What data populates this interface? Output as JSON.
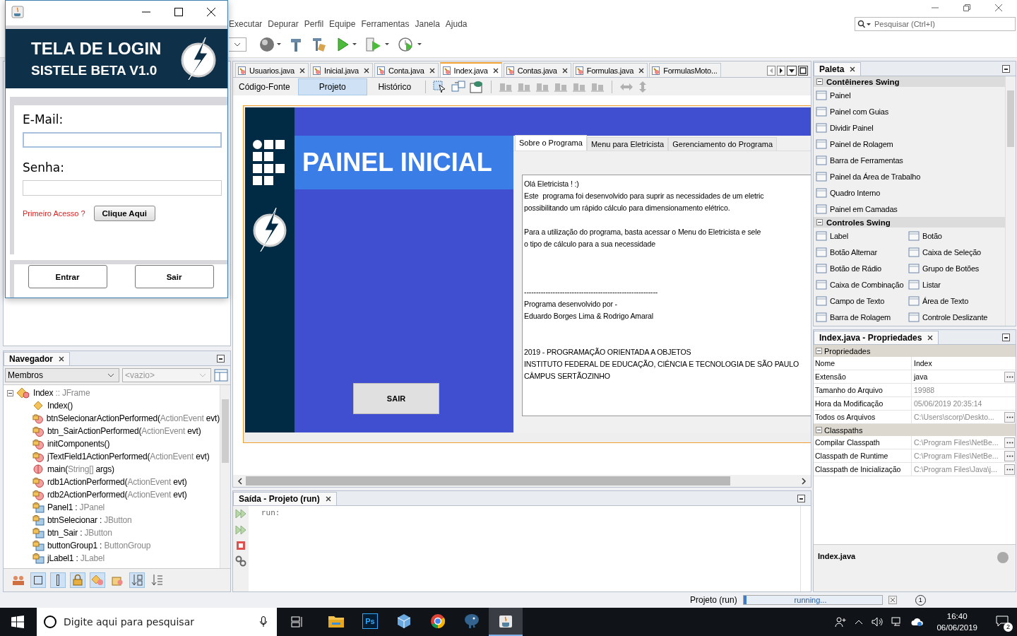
{
  "login_window": {
    "header_title": "TELA DE LOGIN",
    "header_subtitle": "SISTELE BETA V1.0",
    "fields": [
      {
        "label": "E-Mail:",
        "focused": true
      },
      {
        "label": "Senha:",
        "focused": false
      }
    ],
    "first_access_label": "Primeiro Acesso ?",
    "first_access_button": "Clique Aqui",
    "buttons": [
      "Entrar",
      "Sair"
    ]
  },
  "menu": [
    "Executar",
    "Depurar",
    "Perfil",
    "Equipe",
    "Ferramentas",
    "Janela",
    "Ajuda"
  ],
  "search": {
    "placeholder": "Pesquisar (Ctrl+I)"
  },
  "editor_tabs": [
    {
      "label": "Usuarios.java",
      "selected": false
    },
    {
      "label": "Inicial.java",
      "selected": false
    },
    {
      "label": "Conta.java",
      "selected": false
    },
    {
      "label": "Index.java",
      "selected": true
    },
    {
      "label": "Contas.java",
      "selected": false
    },
    {
      "label": "Formulas.java",
      "selected": false
    },
    {
      "label": "FormulasMoto...",
      "selected": false
    }
  ],
  "view_tabs": [
    {
      "label": "Código-Fonte",
      "selected": false
    },
    {
      "label": "Projeto",
      "selected": true
    },
    {
      "label": "Histórico",
      "selected": false
    }
  ],
  "form_preview": {
    "title": "PAINEL INICIAL",
    "exit_button": "SAIR",
    "tabs": [
      {
        "label": "Sobre o Programa",
        "selected": true
      },
      {
        "label": "Menu para Eletricista",
        "selected": false
      },
      {
        "label": "Gerenciamento do Programa",
        "selected": false
      }
    ],
    "paragraphs": [
      [
        "Olá Eletricista ! :)",
        "Este  programa foi desenvolvido para suprir as necessidades de um eletric",
        "possibilitando um rápido cálculo para dimensionamento elétrico."
      ],
      [
        "Para a utilização do programa, basta acessar o Menu do Eletricista e sele",
        "o tipo de cálculo para a sua necessidade"
      ],
      [
        "--------------------------------------------------------",
        "Programa desenvolvido por -",
        "Eduardo Borges Lima & Rodrigo Amaral"
      ],
      [
        "2019 - PROGRAMAÇÃO ORIENTADA A OBJETOS",
        "INSTITUTO FEDERAL DE EDUCAÇÃO, CIÊNCIA E TECNOLOGIA DE SÃO PAULO",
        "CÂMPUS SERTÃOZINHO"
      ]
    ]
  },
  "output": {
    "title": "Saída - Projeto (run)",
    "lines": [
      "run:"
    ]
  },
  "navigator": {
    "title": "Navegador",
    "filters": [
      {
        "value": "Membros",
        "disabled": false
      },
      {
        "value": "<vazio>",
        "disabled": true
      }
    ],
    "tree": [
      {
        "kind": "class",
        "expanded": true,
        "parts": [
          {
            "text": "Index",
            "muted": false
          },
          {
            "text": " :: JFrame",
            "muted": true
          }
        ],
        "children": [
          {
            "kind": "constructor",
            "parts": [
              {
                "text": "Index()",
                "muted": false
              }
            ]
          },
          {
            "kind": "method",
            "parts": [
              {
                "text": "btnSelecionarActionPerformed(",
                "muted": false
              },
              {
                "text": "ActionEvent",
                "muted": true
              },
              {
                "text": " evt)",
                "muted": false
              }
            ]
          },
          {
            "kind": "method",
            "parts": [
              {
                "text": "btn_SairActionPerformed(",
                "muted": false
              },
              {
                "text": "ActionEvent",
                "muted": true
              },
              {
                "text": " evt)",
                "muted": false
              }
            ]
          },
          {
            "kind": "method",
            "parts": [
              {
                "text": "initComponents()",
                "muted": false
              }
            ]
          },
          {
            "kind": "method",
            "parts": [
              {
                "text": "jTextField1ActionPerformed(",
                "muted": false
              },
              {
                "text": "ActionEvent",
                "muted": true
              },
              {
                "text": " evt)",
                "muted": false
              }
            ]
          },
          {
            "kind": "main",
            "parts": [
              {
                "text": "main(",
                "muted": false
              },
              {
                "text": "String[]",
                "muted": true
              },
              {
                "text": " args)",
                "muted": false
              }
            ]
          },
          {
            "kind": "method",
            "parts": [
              {
                "text": "rdb1ActionPerformed(",
                "muted": false
              },
              {
                "text": "ActionEvent",
                "muted": true
              },
              {
                "text": " evt)",
                "muted": false
              }
            ]
          },
          {
            "kind": "method",
            "parts": [
              {
                "text": "rdb2ActionPerformed(",
                "muted": false
              },
              {
                "text": "ActionEvent",
                "muted": true
              },
              {
                "text": " evt)",
                "muted": false
              }
            ]
          },
          {
            "kind": "field",
            "parts": [
              {
                "text": "Panel1 : ",
                "muted": false
              },
              {
                "text": "JPanel",
                "muted": true
              }
            ]
          },
          {
            "kind": "field",
            "parts": [
              {
                "text": "btnSelecionar : ",
                "muted": false
              },
              {
                "text": "JButton",
                "muted": true
              }
            ]
          },
          {
            "kind": "field",
            "parts": [
              {
                "text": "btn_Sair : ",
                "muted": false
              },
              {
                "text": "JButton",
                "muted": true
              }
            ]
          },
          {
            "kind": "field",
            "parts": [
              {
                "text": "buttonGroup1 : ",
                "muted": false
              },
              {
                "text": "ButtonGroup",
                "muted": true
              }
            ]
          },
          {
            "kind": "field",
            "parts": [
              {
                "text": "jLabel1 : ",
                "muted": false
              },
              {
                "text": "JLabel",
                "muted": true
              }
            ]
          }
        ]
      }
    ],
    "tools": [
      {
        "kind": "people",
        "selected": false
      },
      {
        "kind": "square",
        "selected": true
      },
      {
        "kind": "bar",
        "selected": true
      },
      {
        "kind": "lock",
        "selected": true
      },
      {
        "kind": "shape",
        "selected": true
      },
      {
        "kind": "package",
        "selected": false
      },
      {
        "kind": "sort-az",
        "selected": true
      },
      {
        "kind": "sort-list",
        "selected": false
      }
    ]
  },
  "palette": {
    "title": "Paleta",
    "categories": [
      {
        "label": "Contêineres Swing",
        "expanded": true,
        "kind": "list",
        "items": [
          "Painel",
          "Painel com Guias",
          "Dividir Painel",
          "Painel de Rolagem",
          "Barra de Ferramentas",
          "Painel da Área de Trabalho",
          "Quadro Interno",
          "Painel em Camadas"
        ]
      },
      {
        "label": "Controles Swing",
        "expanded": true,
        "kind": "grid",
        "items": [
          "Label",
          "Botão",
          "Botão Alternar",
          "Caixa de Seleção",
          "Botão de Rádio",
          "Grupo de Botões",
          "Caixa de Combinação",
          "Listar",
          "Campo de Texto",
          "Área de Texto",
          "Barra de Rolagem",
          "Controle Deslizante"
        ]
      }
    ]
  },
  "properties": {
    "title": "Index.java - Propriedades",
    "sections": [
      {
        "label": "Propriedades",
        "expanded": true,
        "rows": [
          {
            "name": "Nome",
            "value": "Index",
            "read_only": false,
            "has_editor": false
          },
          {
            "name": "Extensão",
            "value": "java",
            "read_only": false,
            "has_editor": true
          },
          {
            "name": "Tamanho do Arquivo",
            "value": "19988",
            "read_only": true,
            "has_editor": false
          },
          {
            "name": "Hora da Modificação",
            "value": "05/06/2019 20:35:14",
            "read_only": true,
            "has_editor": false
          },
          {
            "name": "Todos os Arquivos",
            "value": "C:\\Users\\scorp\\Deskto...",
            "read_only": true,
            "has_editor": true
          }
        ]
      },
      {
        "label": "Classpaths",
        "expanded": true,
        "rows": [
          {
            "name": "Compilar Classpath",
            "value": "C:\\Program Files\\NetBe...",
            "read_only": true,
            "has_editor": true
          },
          {
            "name": "Classpath de Runtime",
            "value": "C:\\Program Files\\NetBe...",
            "read_only": true,
            "has_editor": true
          },
          {
            "name": "Classpath de Inicialização",
            "value": "C:\\Program Files\\Java\\j...",
            "read_only": true,
            "has_editor": true
          }
        ]
      }
    ],
    "description": "Index.java"
  },
  "status_bar": {
    "task": "Projeto (run)",
    "progress": "running...",
    "level": 0.02,
    "notifications": "1"
  },
  "taskbar": {
    "search_placeholder": "Digite aqui para pesquisar",
    "apps": [
      {
        "kind": "folder",
        "selected": false
      },
      {
        "kind": "photoshop",
        "label": "Ps",
        "selected": false
      },
      {
        "kind": "cube",
        "selected": false
      },
      {
        "kind": "chrome",
        "selected": false
      },
      {
        "kind": "elephant",
        "selected": false
      },
      {
        "kind": "java",
        "selected": true
      }
    ],
    "time": "16:40",
    "date": "06/06/2019",
    "notifications": "2"
  }
}
